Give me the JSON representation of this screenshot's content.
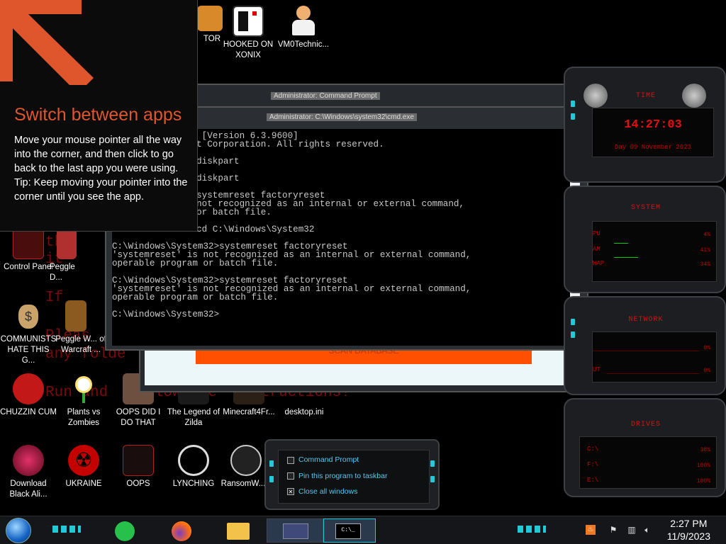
{
  "tooltip": {
    "title": "Switch between apps",
    "body": "Move your mouse pointer all the way into the corner, and then click to go back to the last app you were using.\nTip: Keep moving your pointer into the corner until you see the app."
  },
  "wallpaper_text": [
    "th",
    "it",
    "If",
    "Pleas",
    "any folde",
    "Run and",
    "follow the",
    "instructions!"
  ],
  "desktop_icons": {
    "top": [
      "TOR",
      "HOOKED ON XONIX",
      "VM0Technic..."
    ],
    "left": [
      "Control Panel",
      "Peggle D...",
      "COMMUNISTS HATE THIS G...",
      "Peggle W... of Warcraft ..."
    ],
    "row1": [
      "CHUZZIN CUM",
      "Plants vs Zombies",
      "OOPS DID I DO THAT",
      "The Legend of Zilda",
      "Minecraft4Fr...",
      "desktop.ini"
    ],
    "row2": [
      "Download Black Ali...",
      "UKRAINE",
      "OOPS",
      "LYNCHING",
      "RansomW..."
    ]
  },
  "windows": {
    "back_title": "Administrator: Command Prompt",
    "front_title": "Administrator: C:\\Windows\\system32\\cmd.exe",
    "scan_button": "SCAN DATABASE",
    "cmd_lines": [
      "ws [Version 6.3.9600]",
      "oft Corporation. All rights reserved.",
      "",
      "t>diskpart",
      "",
      "t>diskpart",
      "",
      "t>systemreset factoryreset",
      "s not recognized as an internal or external command,",
      "m or batch file.",
      "",
      "t>cd C:\\Windows\\System32",
      "",
      "C:\\Windows\\System32>systemreset factoryreset",
      "'systemreset' is not recognized as an internal or external command,",
      "operable program or batch file.",
      "",
      "C:\\Windows\\System32>systemreset factoryreset",
      "'systemreset' is not recognized as an internal or external command,",
      "operable program or batch file.",
      "",
      "C:\\Windows\\System32>"
    ]
  },
  "gadgets": {
    "time": {
      "label": "TIME",
      "clock": "14:27:03",
      "date": "Day 09 November 2023"
    },
    "system": {
      "label": "SYSTEM",
      "rows": [
        {
          "name": "PU",
          "value": "4%"
        },
        {
          "name": "AM",
          "value": "41%"
        },
        {
          "name": "WAP",
          "value": "34%"
        }
      ]
    },
    "network": {
      "label": "NETWORK",
      "rows": [
        {
          "name": "",
          "value": "0%"
        },
        {
          "name": "UT",
          "value": "0%"
        }
      ]
    },
    "drives": {
      "label": "DRIVES",
      "rows": [
        {
          "name": "C:\\",
          "value": "38%"
        },
        {
          "name": "F:\\",
          "value": "100%"
        },
        {
          "name": "E:\\",
          "value": "100%"
        }
      ]
    }
  },
  "jumplist": {
    "items": [
      "Command Prompt",
      "Pin this program to taskbar",
      "Close all windows"
    ]
  },
  "taskbar": {
    "time": "2:27 PM",
    "date": "11/9/2023"
  },
  "colors": {
    "accent_orange": "#e0562c",
    "cyan": "#22c9d8",
    "alien_red": "#cc1111"
  }
}
